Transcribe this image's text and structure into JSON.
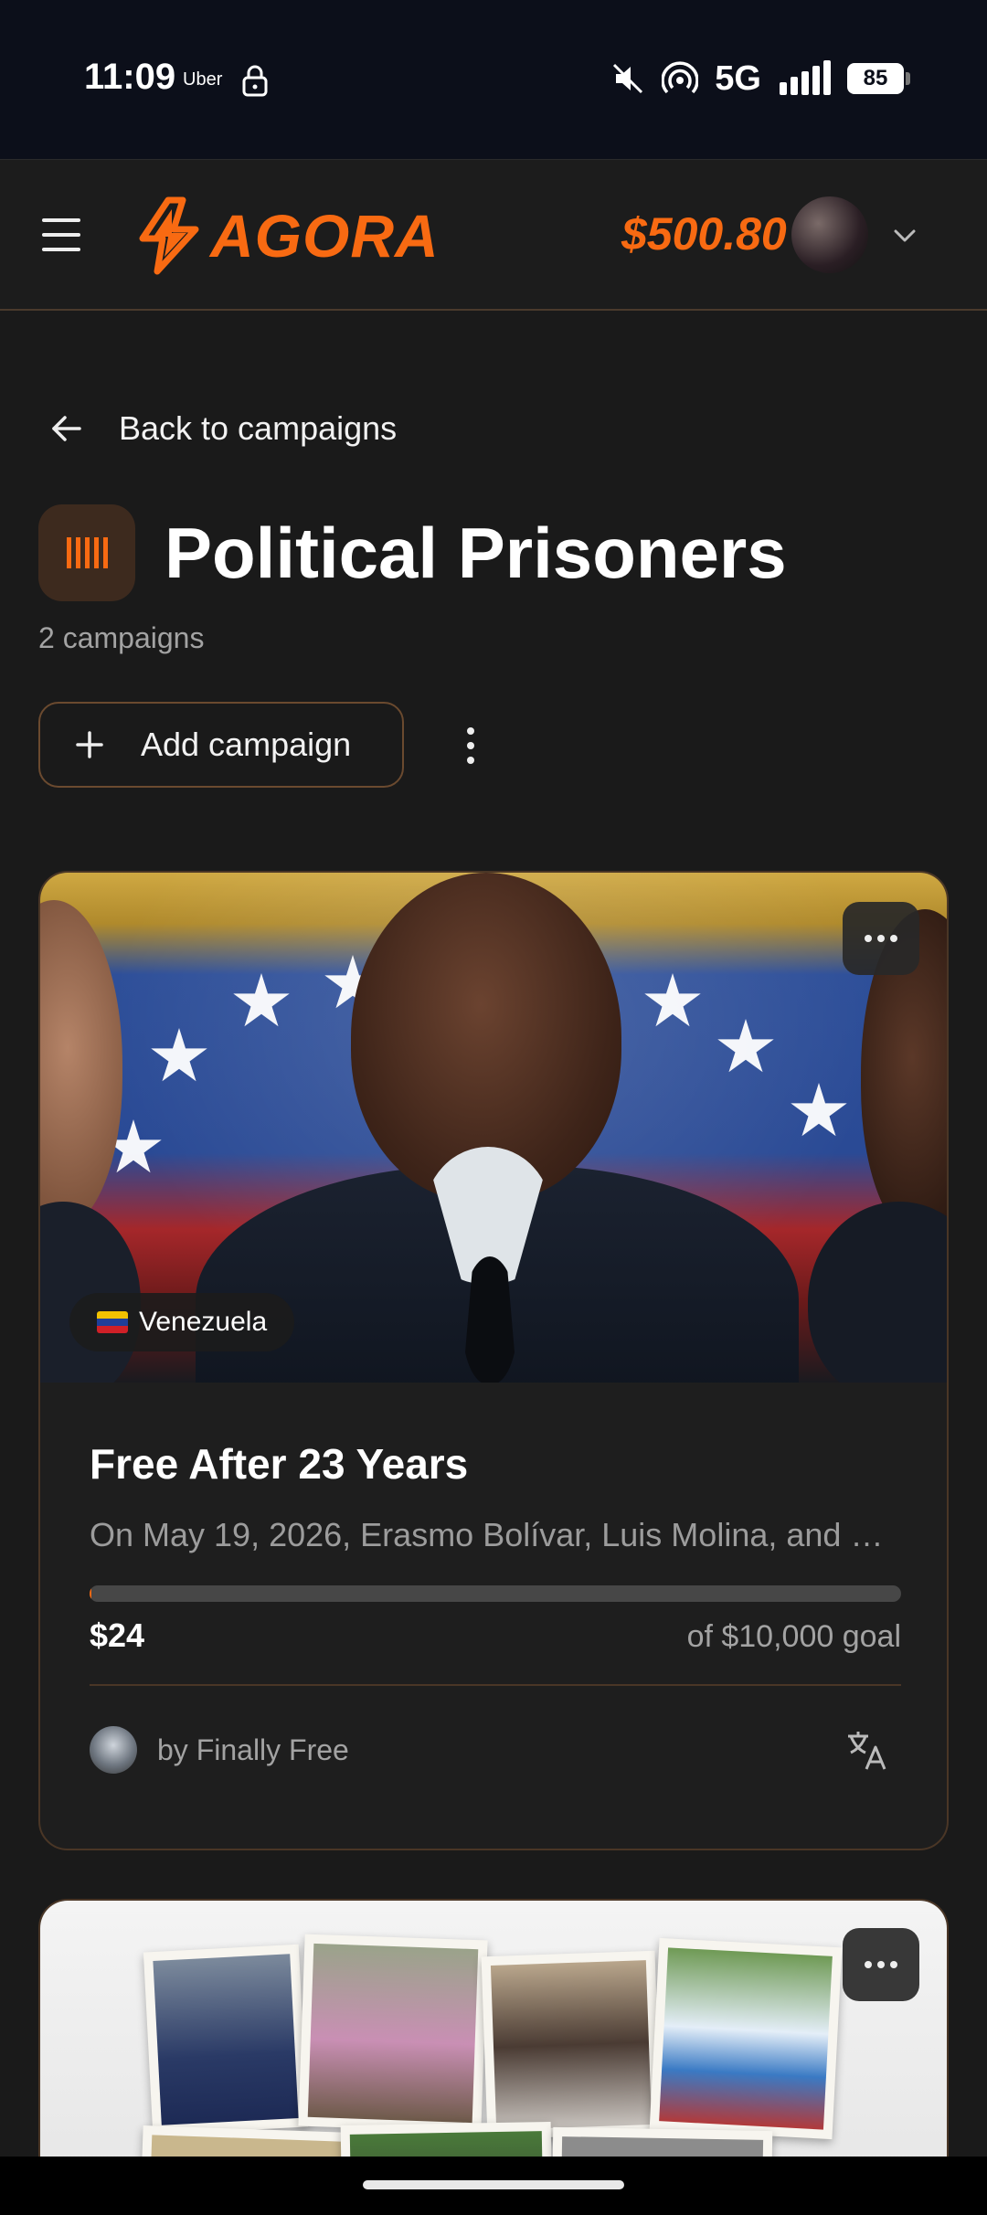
{
  "status_bar": {
    "time": "11:09",
    "app": "Uber",
    "network": "5G",
    "battery": "85"
  },
  "header": {
    "logo_text": "AGORA",
    "balance": "$500.80",
    "accent_color": "#f86a12"
  },
  "nav": {
    "back_label": "Back to campaigns"
  },
  "category": {
    "title": "Political Prisoners",
    "count": "2 campaigns",
    "add_label": "Add campaign"
  },
  "campaigns": [
    {
      "country": "Venezuela",
      "title": "Free After 23 Years",
      "description": "On May 19, 2026, Erasmo Bolívar, Luis Molina, and others",
      "raised": "$24",
      "goal": "of $10,000 goal",
      "progress_fraction": 0.0024,
      "author": "by Finally Free"
    }
  ]
}
